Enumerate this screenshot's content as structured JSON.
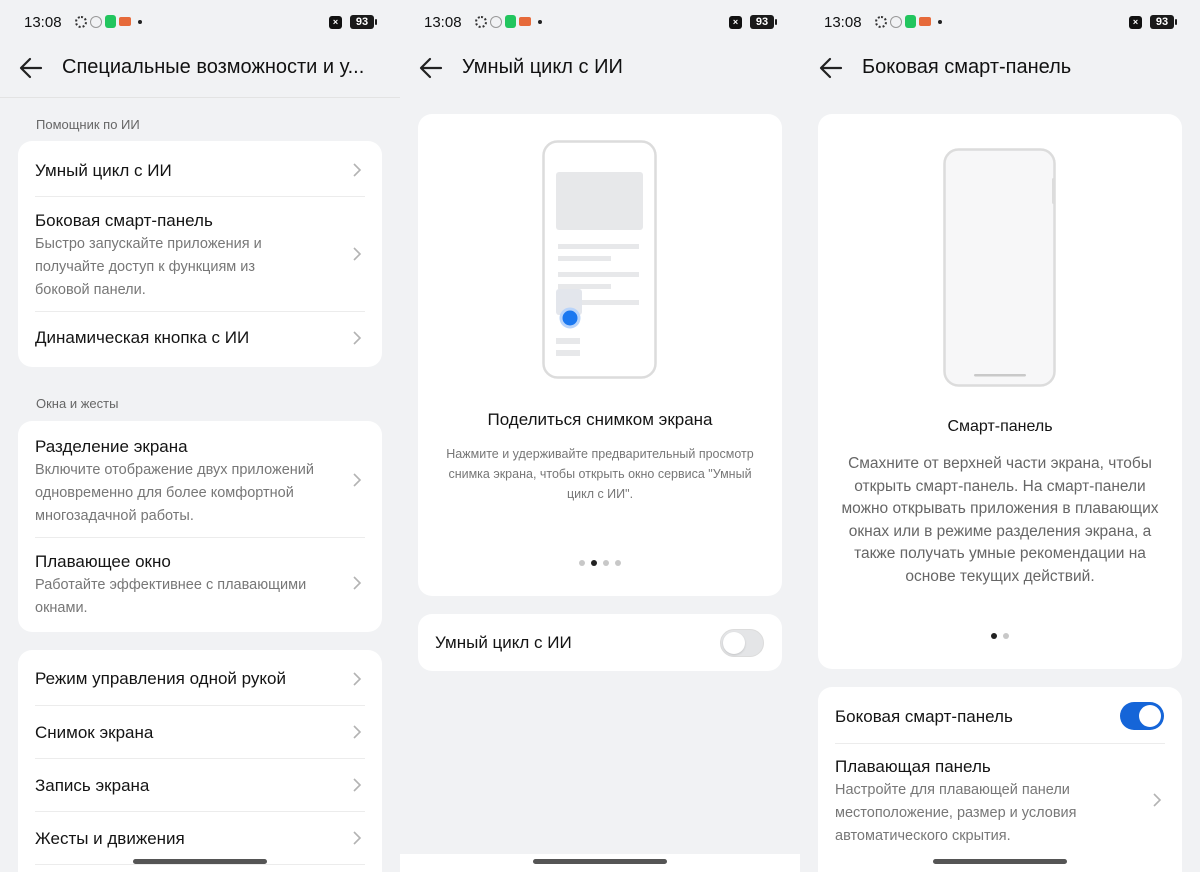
{
  "status": {
    "time": "13:08",
    "battery": "93"
  },
  "colors": {
    "accent": "#1565d8",
    "background": "#f1f2f4",
    "card": "#ffffff"
  },
  "screen1": {
    "title": "Специальные возможности и у...",
    "section_ai": "Помощник по ИИ",
    "item_ai_loop": "Умный цикл с ИИ",
    "item_smart_panel": "Боковая смарт-панель",
    "item_smart_panel_desc": "Быстро запускайте приложения и получайте доступ к функциям из боковой панели.",
    "item_dynamic_btn": "Динамическая кнопка с ИИ",
    "section_windows": "Окна и жесты",
    "item_split": "Разделение экрана",
    "item_split_desc": "Включите отображение двух приложений одновременно для более комфортной многозадачной работы.",
    "item_float": "Плавающее окно",
    "item_float_desc": "Работайте эффективнее с плавающими окнами.",
    "item_one_hand": "Режим управления одной рукой",
    "item_screenshot": "Снимок экрана",
    "item_record": "Запись экрана",
    "item_gestures": "Жесты и движения"
  },
  "screen2": {
    "title": "Умный цикл с ИИ",
    "card_title": "Поделиться снимком экрана",
    "card_desc": "Нажмите и удерживайте предварительный просмотр снимка экрана, чтобы открыть окно сервиса \"Умный цикл с ИИ\".",
    "toggle_label": "Умный цикл с ИИ",
    "toggle_on": false,
    "page_index": 2,
    "page_count": 4
  },
  "screen3": {
    "title": "Боковая смарт-панель",
    "card_title": "Смарт-панель",
    "card_desc": "Смахните от верхней части экрана, чтобы открыть смарт-панель. На смарт-панели можно открывать приложения в плавающих окнах или в режиме разделения экрана, а также получать умные рекомендации на основе текущих действий.",
    "page_index": 1,
    "page_count": 2,
    "toggle_label": "Боковая смарт-панель",
    "toggle_on": true,
    "item_floating": "Плавающая панель",
    "item_floating_desc": "Настройте для плавающей панели местоположение, размер и условия автоматического скрытия."
  }
}
